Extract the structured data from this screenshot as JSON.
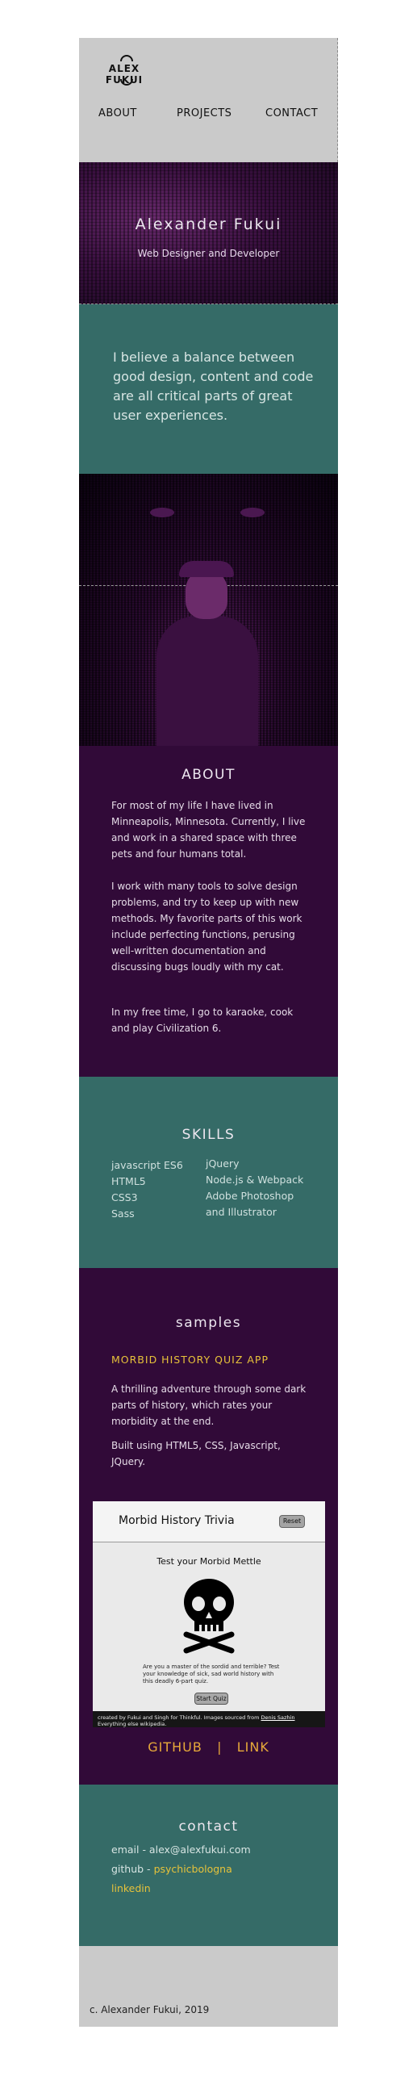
{
  "header": {
    "logo_text": "ALEX FUKUI",
    "nav": [
      {
        "label": "ABOUT"
      },
      {
        "label": "PROJECTS"
      },
      {
        "label": "CONTACT"
      }
    ]
  },
  "hero": {
    "title": "Alexander Fukui",
    "subtitle": "Web Designer and Developer"
  },
  "quote": {
    "text": "I believe a balance between good design, content and code are all critical parts of great user experiences."
  },
  "about": {
    "title": "ABOUT",
    "paragraphs": [
      "For most of my life I have lived in Minneapolis, Minnesota. Currently, I live and work in a shared space with three pets and four humans total.",
      "I work with many tools to solve design problems, and try to keep up with new methods. My favorite parts of this work include perfecting functions, perusing well-written documentation and discussing bugs loudly with my cat.",
      "In my free time, I go to karaoke, cook and play Civilization 6."
    ]
  },
  "skills": {
    "title": "SKILLS",
    "left": [
      "javascript ES6",
      "HTML5",
      "CSS3",
      "Sass"
    ],
    "right": [
      "jQuery",
      "Node.js & Webpack",
      "Adobe Photoshop",
      "and Illustrator"
    ]
  },
  "samples": {
    "title": "samples",
    "project_name": "MORBID HISTORY QUIZ APP",
    "paragraphs": [
      "A thrilling adventure through some dark parts of history, which rates your morbidity at the end.",
      "Built using HTML5, CSS, Javascript, JQuery."
    ],
    "preview": {
      "app_title": "Morbid History Trivia",
      "reset_label": "Reset",
      "heading": "Test your Morbid Mettle",
      "question": "Are you a master of the sordid and terrible? Test your knowledge of sick, sad world history with this deadly 6-part quiz.",
      "start_label": "Start Quiz",
      "credit_text": "created by Fukui and Singh for Thinkful. Images sourced from",
      "credit_link": "Denis Sazhin",
      "credit_tail": "Everything else wikipedia."
    },
    "github_label": "GITHUB",
    "separator": "|",
    "link_label": "LINK"
  },
  "contact": {
    "title": "contact",
    "email": "email - alex@alexfukui.com",
    "github_prefix": "github -",
    "github_handle": "psychicbologna",
    "linkedin": "linkedin"
  },
  "footer": {
    "copyright": "c. Alexander Fukui, 2019"
  },
  "colors": {
    "header_gray": "#cacaca",
    "teal": "#356b67",
    "plum": "#310a38",
    "accent_yellow": "#e7c23a"
  }
}
